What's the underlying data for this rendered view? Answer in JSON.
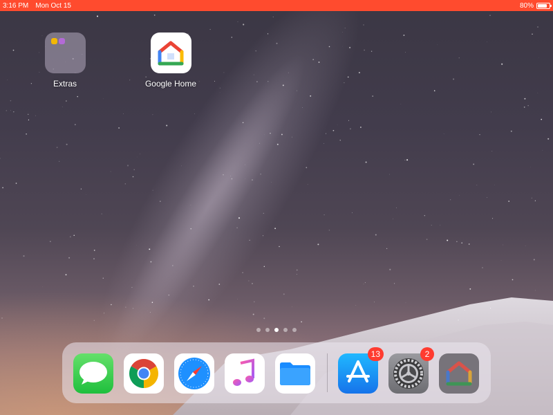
{
  "status_bar": {
    "time": "3:16 PM",
    "date": "Mon Oct 15",
    "battery": "80%",
    "battery_level": 0.8
  },
  "home_apps": [
    {
      "label": "Extras",
      "icon": "folder-icon"
    },
    {
      "label": "Google Home",
      "icon": "google-home-icon"
    }
  ],
  "page_indicator": {
    "pages": 5,
    "current": 3
  },
  "dock": {
    "apps": [
      {
        "name": "Messages",
        "icon": "messages-icon"
      },
      {
        "name": "Chrome",
        "icon": "chrome-icon"
      },
      {
        "name": "Safari",
        "icon": "safari-icon"
      },
      {
        "name": "Music",
        "icon": "music-icon"
      },
      {
        "name": "Files",
        "icon": "files-icon"
      },
      {
        "name": "App Store",
        "icon": "app-store-icon",
        "badge": "13"
      },
      {
        "name": "Settings",
        "icon": "settings-icon",
        "badge": "2"
      },
      {
        "name": "Google Home",
        "icon": "google-home-icon"
      }
    ]
  },
  "colors": {
    "status_bar": "#ff4b2e",
    "badge": "#ff3b30"
  }
}
